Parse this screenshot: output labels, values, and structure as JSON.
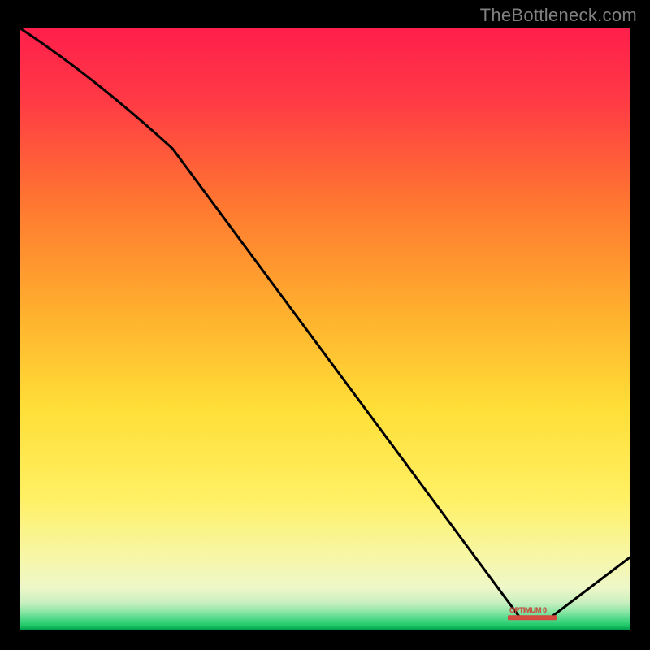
{
  "watermark": "TheBottleneck.com",
  "marker_label": "OPTIMUM 0",
  "chart_data": {
    "type": "line",
    "title": "",
    "xlabel": "",
    "ylabel": "",
    "xlim": [
      0,
      100
    ],
    "ylim": [
      0,
      100
    ],
    "background_gradient": {
      "top": "#ff1f4b",
      "mid_upper": "#ff8a2a",
      "mid": "#ffe23c",
      "lower": "#f5f59a",
      "bottom_band": "#2fd87a",
      "bottom_line": "#00a855"
    },
    "curve": {
      "description": "Bottleneck curve: high on the left, descends steeply to an optimum near the right, then rises slightly",
      "points": [
        {
          "x": 0,
          "y": 100
        },
        {
          "x": 25,
          "y": 80
        },
        {
          "x": 82,
          "y": 2
        },
        {
          "x": 87,
          "y": 2
        },
        {
          "x": 100,
          "y": 12
        }
      ]
    },
    "optimum": {
      "x_start": 80,
      "x_end": 88,
      "y": 2,
      "label": "OPTIMUM 0"
    }
  }
}
